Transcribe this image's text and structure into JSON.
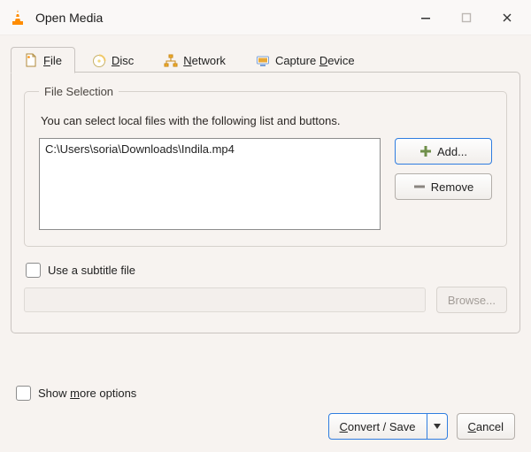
{
  "window": {
    "title": "Open Media",
    "app_icon": "vlc-cone-icon"
  },
  "tabs": [
    {
      "id": "file",
      "icon": "file-icon",
      "pre": "",
      "hot": "F",
      "post": "ile",
      "active": true
    },
    {
      "id": "disc",
      "icon": "disc-icon",
      "pre": "",
      "hot": "D",
      "post": "isc",
      "active": false
    },
    {
      "id": "network",
      "icon": "network-icon",
      "pre": "",
      "hot": "N",
      "post": "etwork",
      "active": false
    },
    {
      "id": "capture",
      "icon": "capture-icon",
      "pre": "Capture ",
      "hot": "D",
      "post": "evice",
      "active": false
    }
  ],
  "file_selection": {
    "legend": "File Selection",
    "help": "You can select local files with the following list and buttons.",
    "files": [
      "C:\\Users\\soria\\Downloads\\Indila.mp4"
    ],
    "add_label": "Add...",
    "remove_label": "Remove"
  },
  "subtitle": {
    "checkbox_label": "Use a subtitle file",
    "browse_label": "Browse...",
    "path": "",
    "enabled": false
  },
  "more_options": {
    "pre": "Show ",
    "hot": "m",
    "post": "ore options",
    "checked": false
  },
  "actions": {
    "convert_pre": "",
    "convert_hot": "C",
    "convert_post": "onvert / Save",
    "cancel_pre": "",
    "cancel_hot": "C",
    "cancel_post": "ancel"
  }
}
